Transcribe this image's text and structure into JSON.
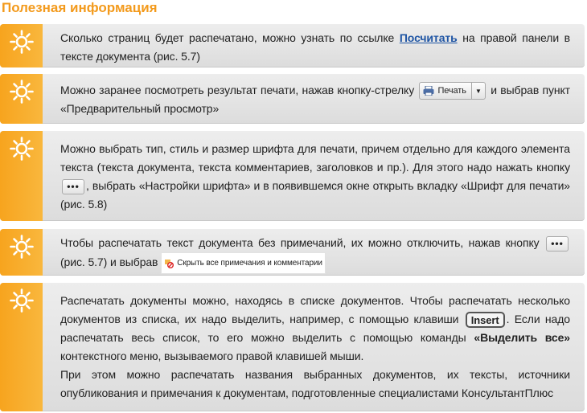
{
  "title": "Полезная информация",
  "colors": {
    "accent": "#f39a1c",
    "link": "#1f55a4",
    "icon_bg": "#f7a41e"
  },
  "icons": [
    "sun-icon",
    "printer-icon",
    "dropdown-arrow-icon",
    "ellipsis-icon",
    "hide-comments-icon"
  ],
  "tips": [
    {
      "t1": "Сколько страниц будет распечатано, можно узнать по ссылке ",
      "link": "Посчитать",
      "t2": " на правой панели в тексте документа (рис. 5.7)"
    },
    {
      "t1": "Можно заранее посмотреть результат печати, нажав кнопку-стрелку ",
      "button": "Печать",
      "t2": " и выбрав пункт «Предварительный просмотр»"
    },
    {
      "t1": "Можно выбрать тип, стиль и размер шрифта для печати, причем отдельно для каждого элемента текста (текста документа, текста комментариев, заголовков и пр.). Для этого надо нажать кнопку ",
      "button": "•••",
      "t2": ", выбрать «Настройки шрифта» и в появившемся окне открыть вкладку «Шрифт для печати» (рис. 5.8)"
    },
    {
      "t1": "Чтобы распечатать текст документа без примечаний, их можно отключить, нажав кнопку ",
      "button": "•••",
      "t2": " (рис. 5.7) и выбрав ",
      "menu_item": "Скрыть все примечания и комментарии"
    },
    {
      "t1": "Распечатать документы можно, находясь в списке документов. Чтобы распечатать несколько документов из списка, их надо выделить, например, с помощью клавиши ",
      "key": "Insert",
      "t2": ". Если надо распечатать весь список, то его можно выделить с помощью команды ",
      "command": "«Выделить все»",
      "t3": " контекстного меню, вызываемого правой клавишей мыши.",
      "t4": "При этом можно распечатать названия выбранных документов, их тексты, источники опубликования и примечания к документам, подготовленные специалистами КонсультантПлюс"
    }
  ]
}
